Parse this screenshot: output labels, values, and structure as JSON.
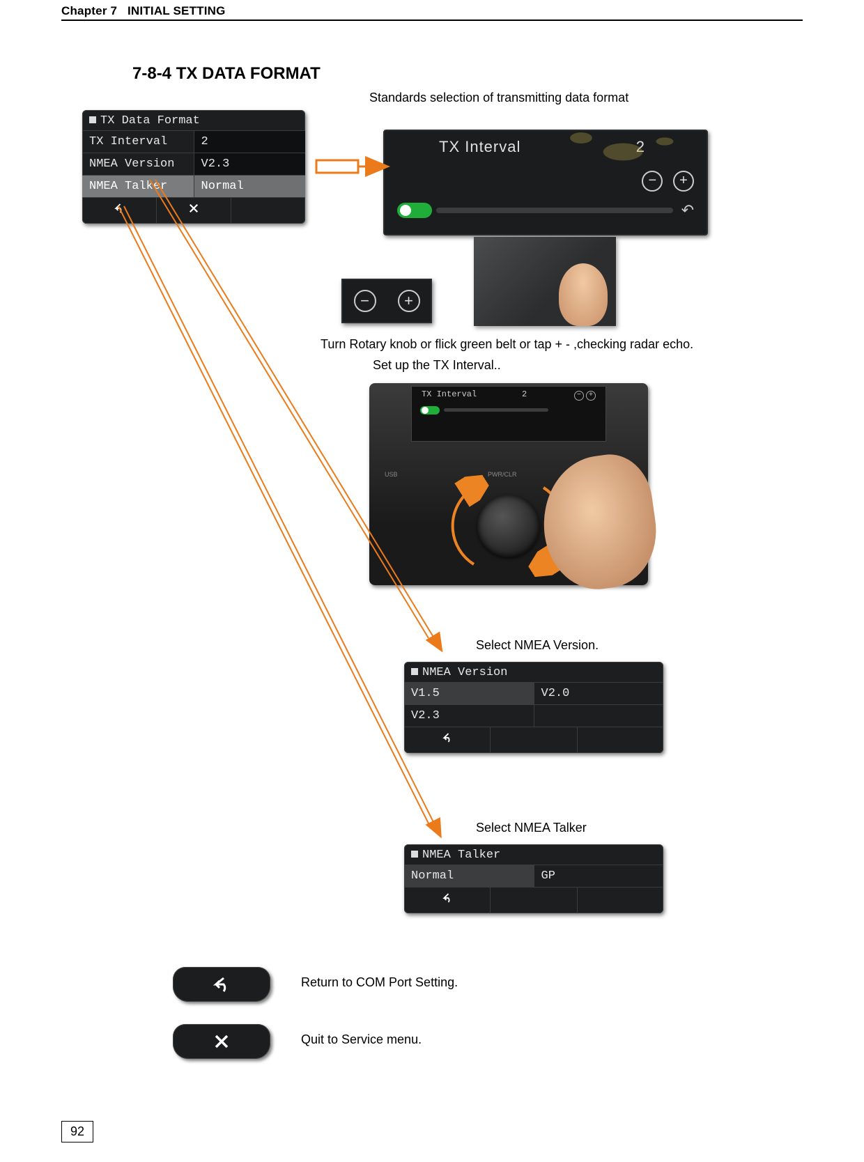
{
  "header": {
    "chapter": "Chapter 7",
    "title": "INITIAL SETTING"
  },
  "section_title": "7-8-4 TX DATA FORMAT",
  "subtitle": "Standards selection of transmitting data format",
  "tx_format_panel": {
    "title": "TX Data Format",
    "rows": [
      {
        "label": "TX Interval",
        "value": "2"
      },
      {
        "label": "NMEA Version",
        "value": "V2.3"
      },
      {
        "label": "NMEA Talker",
        "value": "Normal"
      }
    ]
  },
  "large_interval": {
    "label": "TX Interval",
    "value": "2"
  },
  "instruction_rotary": "Turn Rotary knob or flick green belt or tap + - ,checking radar echo.",
  "instruction_setup": "Set up the TX Interval..",
  "device": {
    "screen_label": "TX Interval",
    "screen_value": "2",
    "port_usb": "USB",
    "btn_pwr": "PWR/CLR"
  },
  "nmea_version_label": "Select NMEA Version.",
  "nmea_version_panel": {
    "title": "NMEA Version",
    "options": [
      "V1.5",
      "V2.0",
      "V2.3"
    ]
  },
  "nmea_talker_label": "Select NMEA Talker",
  "nmea_talker_panel": {
    "title": "NMEA Talker",
    "options": [
      "Normal",
      "GP"
    ]
  },
  "return_label": "Return to COM Port Setting.",
  "quit_label": "Quit to Service menu.",
  "page_number": "92"
}
